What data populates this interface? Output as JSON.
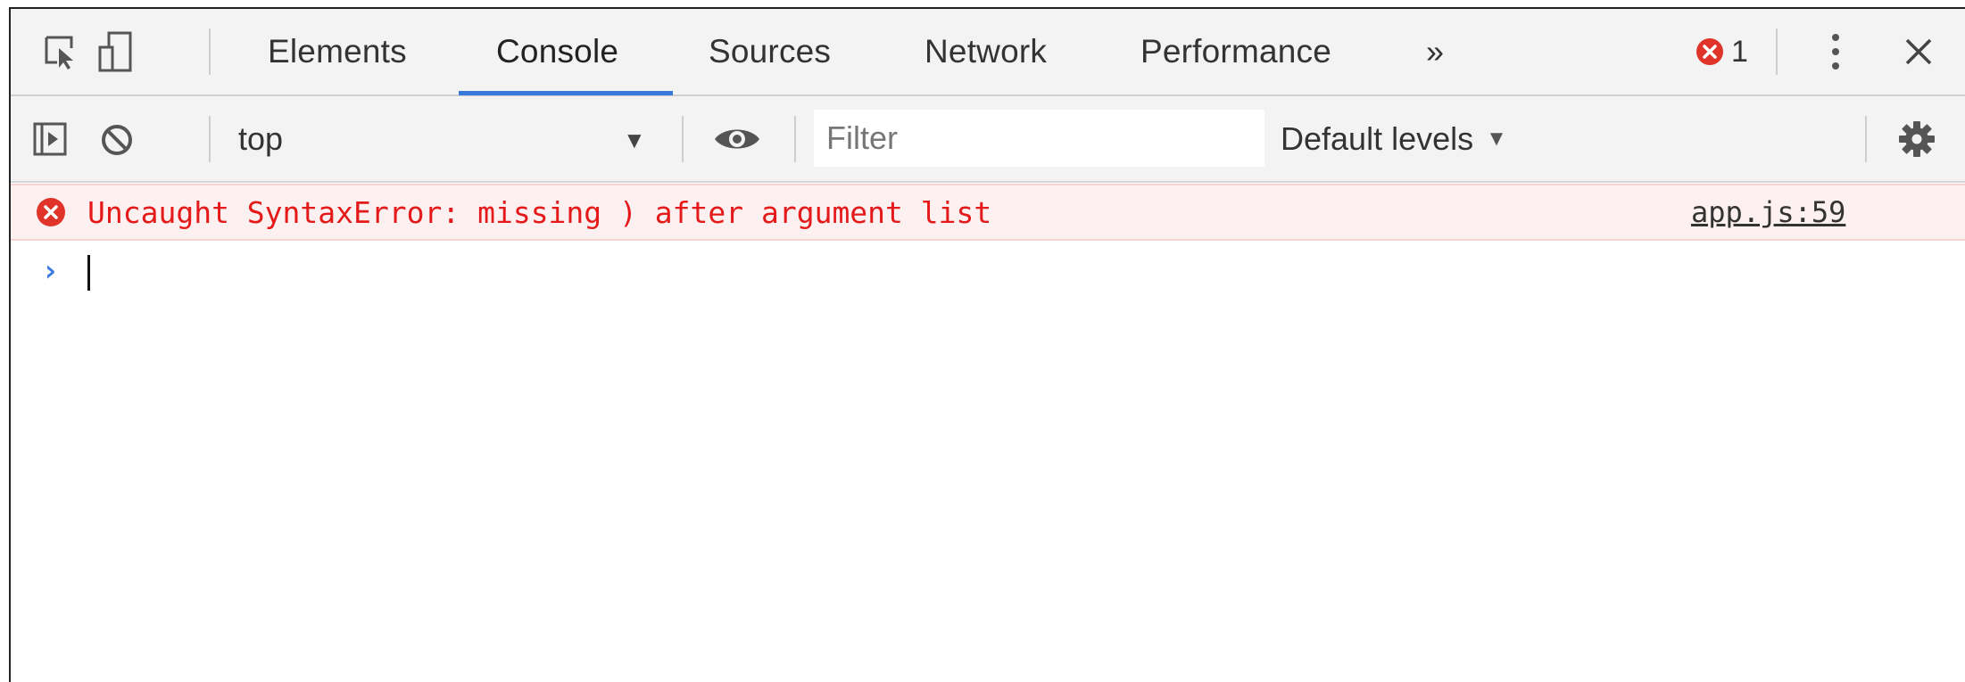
{
  "tabs": [
    {
      "label": "Elements",
      "active": false
    },
    {
      "label": "Console",
      "active": true
    },
    {
      "label": "Sources",
      "active": false
    },
    {
      "label": "Network",
      "active": false
    },
    {
      "label": "Performance",
      "active": false
    }
  ],
  "tabbar": {
    "more_tabs_label": "»",
    "error_count": "1",
    "icons": {
      "inspect": "inspect-element-icon",
      "device": "device-toolbar-icon",
      "error": "error-icon",
      "menu": "kebab-menu-icon",
      "close": "close-icon"
    }
  },
  "toolbar": {
    "context": "top",
    "filter_placeholder": "Filter",
    "filter_value": "",
    "levels_label": "Default levels",
    "levels_caret": "▼",
    "context_caret": "▼",
    "icons": {
      "sidebar": "show-sidebar-icon",
      "clear": "clear-console-icon",
      "live_expression": "eye-icon",
      "settings": "gear-icon"
    }
  },
  "console": {
    "messages": [
      {
        "level": "error",
        "text": "Uncaught SyntaxError: missing ) after argument list",
        "source": "app.js:59"
      }
    ],
    "prompt_symbol": "›",
    "input_value": ""
  },
  "colors": {
    "accent": "#3879d9",
    "error_text": "#e41a1a",
    "error_bg": "#fdf0f0",
    "error_icon": "#e0342a",
    "prompt": "#3b7be0"
  }
}
